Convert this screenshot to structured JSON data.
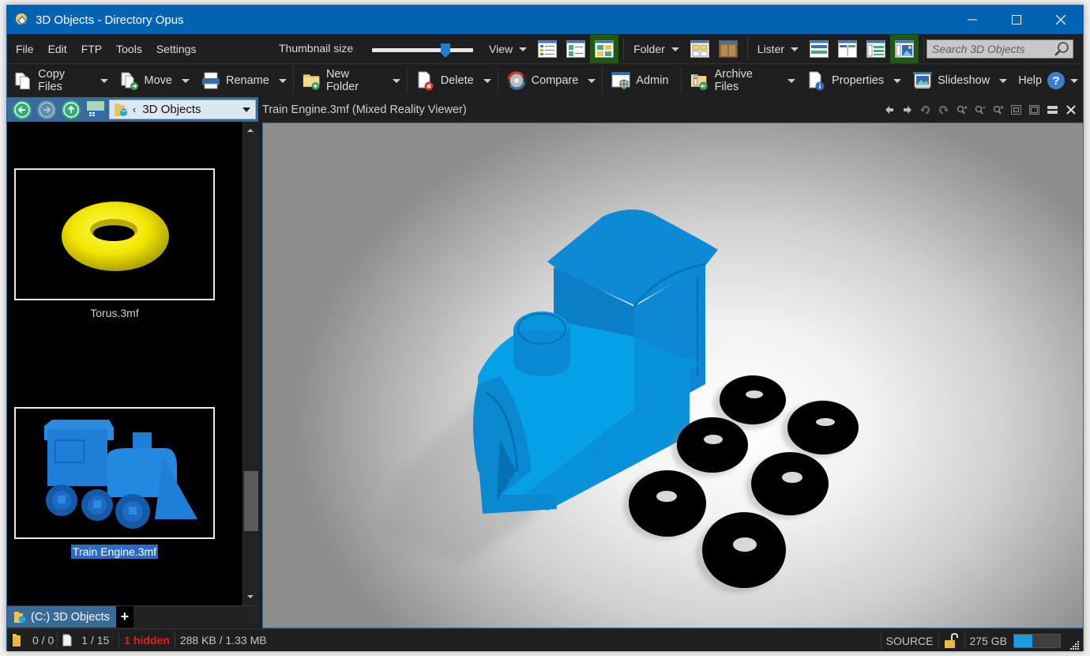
{
  "window": {
    "title": "3D Objects - Directory Opus",
    "controls": {
      "minimize": "minimize-icon",
      "maximize": "maximize-icon",
      "close": "close-icon"
    }
  },
  "menubar": {
    "items": [
      "File",
      "Edit",
      "FTP",
      "Tools",
      "Settings"
    ],
    "thumbnail_size_label": "Thumbnail size",
    "thumbnail_size_value": 0.75,
    "view_label": "View",
    "folder_label": "Folder",
    "lister_label": "Lister",
    "search_placeholder": "Search 3D Objects"
  },
  "toolbar": {
    "items": [
      {
        "label": "Copy Files",
        "icon": "copy-files-icon",
        "dropdown": true
      },
      {
        "label": "Move",
        "icon": "move-icon",
        "dropdown": true
      },
      {
        "label": "Rename",
        "icon": "rename-icon",
        "dropdown": true
      },
      {
        "label": "New Folder",
        "icon": "new-folder-icon",
        "dropdown": true
      },
      {
        "label": "Delete",
        "icon": "delete-icon",
        "dropdown": true
      },
      {
        "label": "Compare",
        "icon": "compare-icon",
        "dropdown": true
      },
      {
        "label": "Admin",
        "icon": "admin-icon",
        "dropdown": false
      },
      {
        "label": "Archive Files",
        "icon": "archive-icon",
        "dropdown": true
      },
      {
        "label": "Properties",
        "icon": "properties-icon",
        "dropdown": true
      },
      {
        "label": "Slideshow",
        "icon": "slideshow-icon",
        "dropdown": true
      }
    ],
    "help_label": "Help"
  },
  "navbar": {
    "path_current": "3D Objects",
    "path_separator": "‹"
  },
  "viewer": {
    "title": "Train Engine.3mf (Mixed Reality Viewer)",
    "tools": [
      "previous-icon",
      "next-icon",
      "rotate-left-icon",
      "rotate-right-icon",
      "zoom-in-icon",
      "zoom-out-icon",
      "zoom-reset-icon",
      "fit-icon",
      "fullsize-icon",
      "split-icon",
      "close-icon"
    ]
  },
  "files": [
    {
      "name": "Torus.3mf",
      "selected": false,
      "color": "#f2e600"
    },
    {
      "name": "Train Engine.3mf",
      "selected": true,
      "color": "#1f87e0"
    }
  ],
  "tabs": [
    {
      "label": "(C:) 3D Objects"
    }
  ],
  "tab_add_label": "+",
  "status": {
    "folders": "0 / 0",
    "files": "1 / 15",
    "hidden": "1 hidden",
    "size": "288 KB / 1.33 MB",
    "source": "SOURCE",
    "free_space": "275 GB",
    "disk_used_fraction": 0.4
  },
  "colors": {
    "titlebar": "#0063b1",
    "accent_active": "#1e5b10",
    "selection": "#2a6bc4",
    "model_blue": "#0095e0",
    "hidden_red": "#e02020"
  }
}
